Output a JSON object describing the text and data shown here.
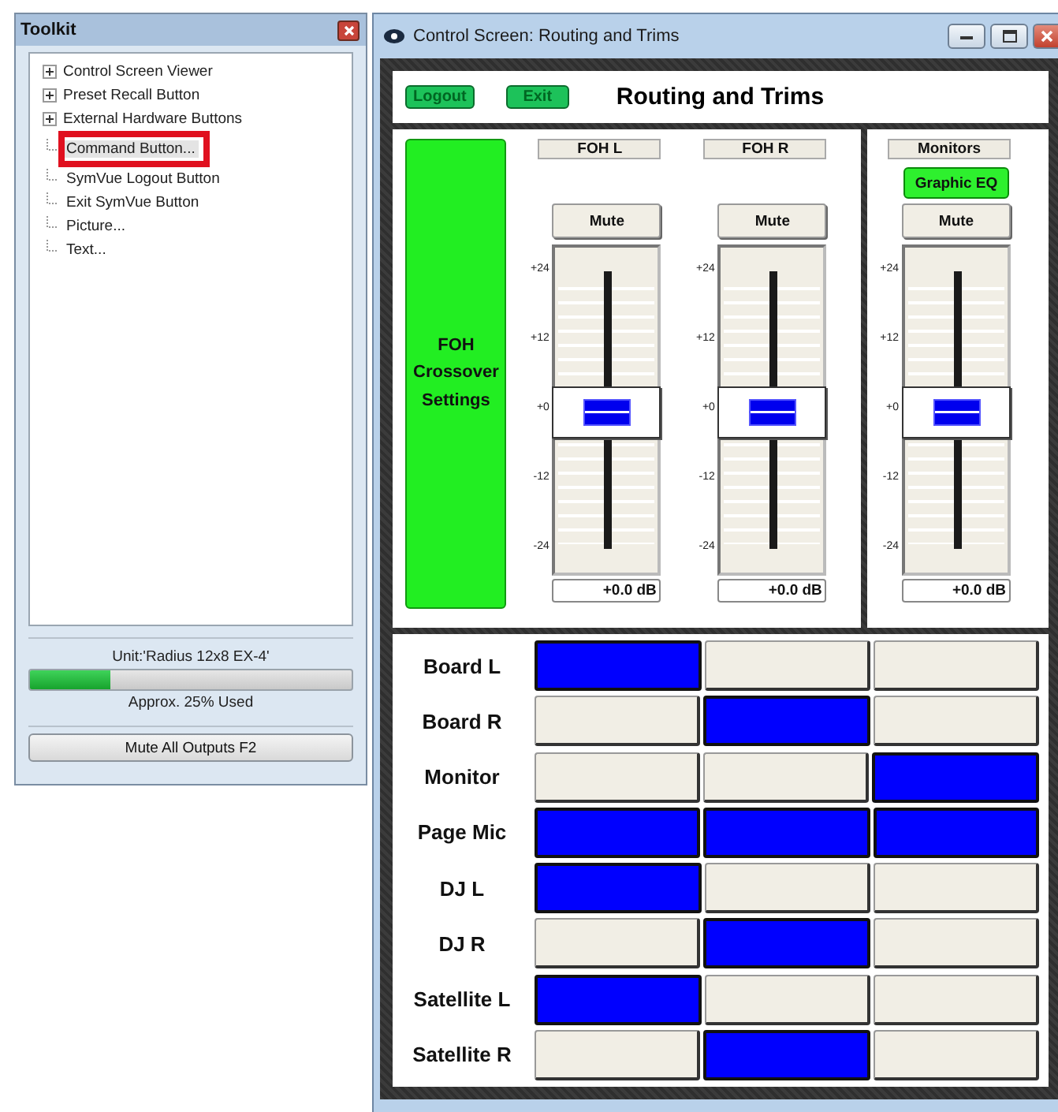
{
  "toolkit": {
    "title": "Toolkit",
    "tree": [
      {
        "label": "Control Screen Viewer",
        "kind": "folder",
        "expanded": false,
        "selected": false
      },
      {
        "label": "Preset Recall Button",
        "kind": "folder",
        "expanded": false,
        "selected": false
      },
      {
        "label": "External Hardware Buttons",
        "kind": "folder",
        "expanded": false,
        "selected": false
      },
      {
        "label": "Command Button...",
        "kind": "leaf",
        "selected": true
      },
      {
        "label": "SymVue Logout Button",
        "kind": "leaf",
        "selected": false
      },
      {
        "label": "Exit SymVue Button",
        "kind": "leaf",
        "selected": false
      },
      {
        "label": "Picture...",
        "kind": "leaf",
        "selected": false
      },
      {
        "label": "Text...",
        "kind": "leaf",
        "selected": false
      }
    ],
    "unit": "Unit:'Radius 12x8 EX-4'",
    "usage": {
      "level": 0.25,
      "text": "Approx. 25% Used"
    },
    "button": "Mute All Outputs  F2"
  },
  "window": {
    "title": "Control Screen: Routing and Trims",
    "header": {
      "buttons": [
        "Logout",
        "Exit"
      ],
      "title": "Routing and Trims"
    },
    "crossover_button": "FOH Crossover Settings",
    "channels": [
      {
        "name": "FOH L",
        "kind": "main",
        "mute": "Mute",
        "muted": false,
        "level": 0.5,
        "reading": "+0.0 dB",
        "ticks": [
          "+24",
          "+12",
          "+0",
          "-12",
          "-24"
        ]
      },
      {
        "name": "FOH R",
        "kind": "main",
        "mute": "Mute",
        "muted": false,
        "level": 0.5,
        "reading": "+0.0 dB",
        "ticks": [
          "+24",
          "+12",
          "+0",
          "-12",
          "-24"
        ]
      },
      {
        "name": "Monitors",
        "kind": "side",
        "extra_button": "Graphic EQ",
        "mute": "Mute",
        "muted": false,
        "level": 0.5,
        "reading": "+0.0 dB",
        "ticks": [
          "+24",
          "+12",
          "+0",
          "-12",
          "-24"
        ]
      }
    ],
    "routing": [
      {
        "name": "Board L",
        "cells": [
          true,
          false,
          false
        ]
      },
      {
        "name": "Board R",
        "cells": [
          false,
          true,
          false
        ]
      },
      {
        "name": "Monitor",
        "cells": [
          false,
          false,
          true
        ]
      },
      {
        "name": "Page Mic",
        "cells": [
          true,
          true,
          true
        ]
      },
      {
        "name": "DJ L",
        "cells": [
          true,
          false,
          false
        ]
      },
      {
        "name": "DJ R",
        "cells": [
          false,
          true,
          false
        ]
      },
      {
        "name": "Satellite L",
        "cells": [
          true,
          false,
          false
        ]
      },
      {
        "name": "Satellite R",
        "cells": [
          false,
          true,
          false
        ]
      }
    ]
  }
}
